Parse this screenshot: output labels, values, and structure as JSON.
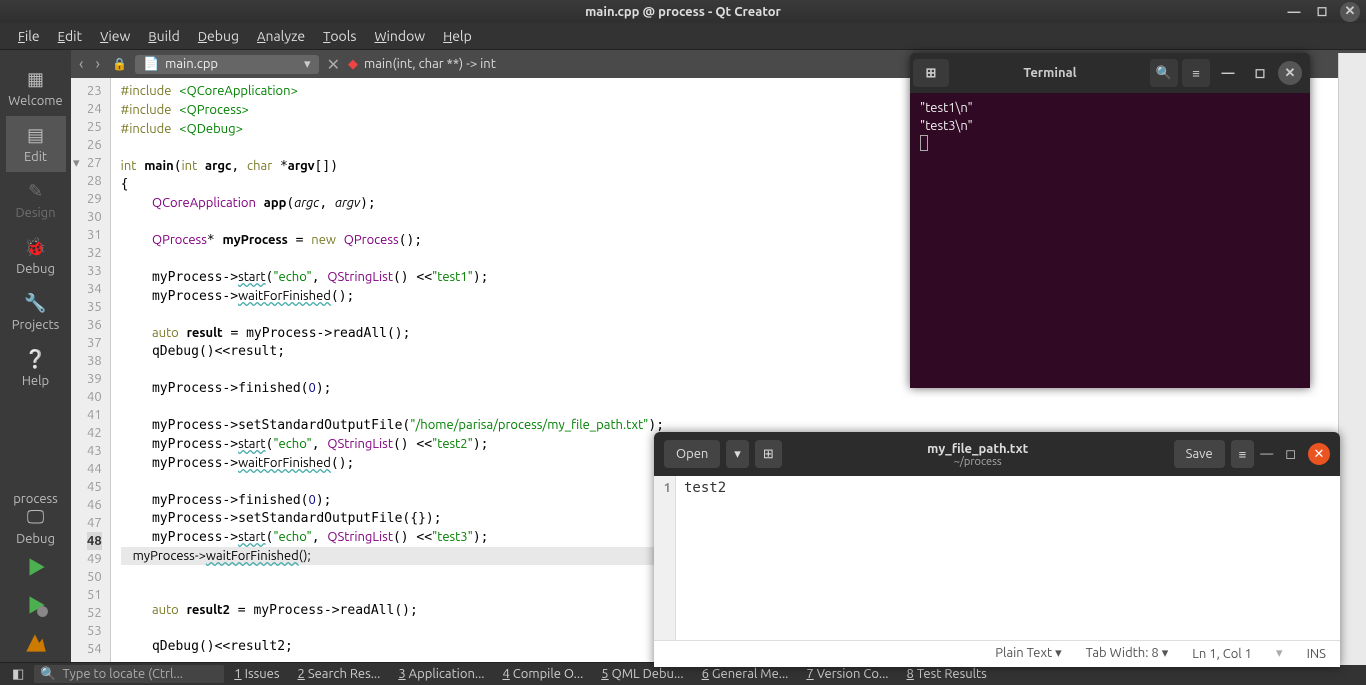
{
  "title": "main.cpp @ process - Qt Creator",
  "menu": [
    "File",
    "Edit",
    "View",
    "Build",
    "Debug",
    "Analyze",
    "Tools",
    "Window",
    "Help"
  ],
  "sidebar": {
    "welcome": "Welcome",
    "edit": "Edit",
    "design": "Design",
    "debug": "Debug",
    "projects": "Projects",
    "help": "Help",
    "kit": "process",
    "run": "Debug"
  },
  "tabs": {
    "file": "main.cpp",
    "sig": "main(int, char **) -> int"
  },
  "code": {
    "lines": [
      23,
      24,
      25,
      26,
      27,
      28,
      29,
      30,
      31,
      32,
      33,
      34,
      35,
      36,
      37,
      38,
      39,
      40,
      41,
      42,
      43,
      44,
      45,
      46,
      47,
      48,
      49,
      50,
      51,
      52,
      53,
      54
    ],
    "highlight": 48
  },
  "term": {
    "title": "Terminal",
    "l1": "\"test1\\n\"",
    "l2": "\"test3\\n\""
  },
  "gedit": {
    "open": "Open",
    "save": "Save",
    "title": "my_file_path.txt",
    "sub": "~/process",
    "ln": "1",
    "txt": "test2",
    "ft": "Plain Text ▾",
    "tw": "Tab Width: 8 ▾",
    "pos": "Ln 1, Col 1",
    "ins": "INS"
  },
  "status": {
    "search": "Type to locate (Ctrl...",
    "i1": "Issues",
    "i2": "Search Res...",
    "i3": "Application...",
    "i4": "Compile O...",
    "i5": "QML Debu...",
    "i6": "General Me...",
    "i7": "Version Co...",
    "i8": "Test Results"
  }
}
